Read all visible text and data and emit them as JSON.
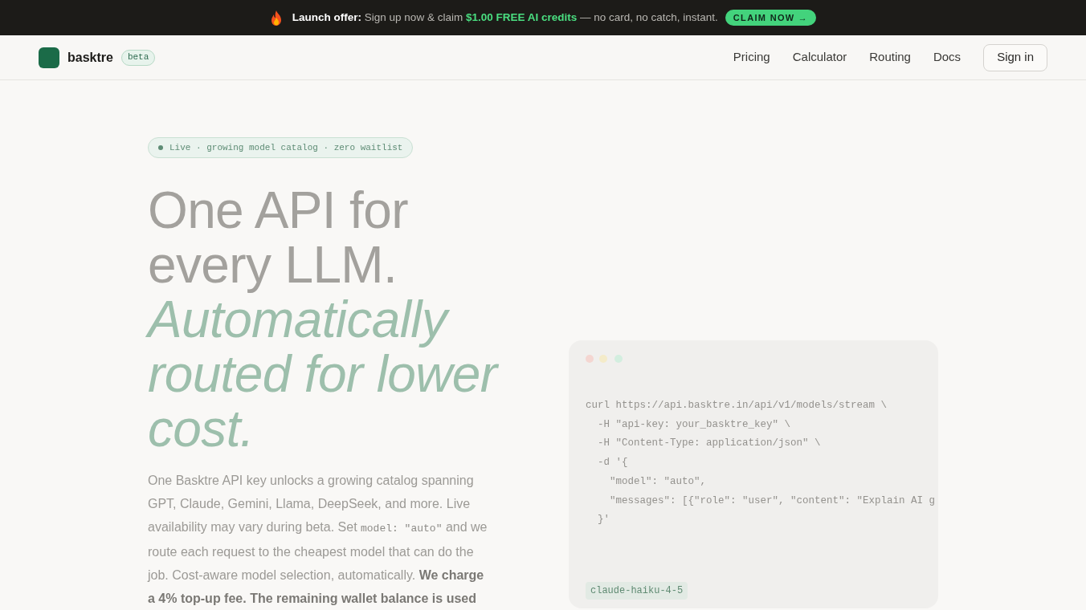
{
  "banner": {
    "message": [
      {
        "kind": "lead",
        "text": "Launch offer:"
      },
      {
        "kind": "plain",
        "text": "Sign up now & claim"
      },
      {
        "kind": "highlight",
        "text": "$1.00 FREE AI credits"
      },
      {
        "kind": "plain",
        "text": "— no card, no catch, instant."
      }
    ],
    "button": "CLAIM NOW →"
  },
  "nav": {
    "brand": "basktre",
    "badge": "beta",
    "links": [
      "Pricing",
      "Calculator",
      "Routing",
      "Docs"
    ],
    "sign_in": "Sign in"
  },
  "hero": {
    "status_badge": "Live · growing model catalog · zero waitlist",
    "headline": "One API for every LLM.",
    "headline_accent": "Automatically routed for lower cost.",
    "intro": [
      {
        "kind": "text",
        "text": "One Basktre API key unlocks a growing catalog spanning GPT, Claude, Gemini, Llama, DeepSeek, and more. Live availability may vary during beta. Set "
      },
      {
        "kind": "code",
        "text": "model: \"auto\""
      },
      {
        "kind": "text",
        "text": " and we route each request to the cheapest model that can do the job. Cost-aware model selection, automatically. **We charge a 4% top-up fee. The remaining wallet balance is used**"
      }
    ]
  },
  "code_window": {
    "lines": [
      "curl https://api.basktre.in/api/v1/models/stream \\",
      "  -H \"api-key: your_basktre_key\" \\",
      "  -H \"Content-Type: application/json\" \\",
      "  -d '{",
      "    \"model\": \"auto\",",
      "    \"messages\": [{\"role\": \"user\", \"content\": \"Explain AI g",
      "  }'"
    ],
    "model_tag": "claude-haiku-4-5"
  }
}
